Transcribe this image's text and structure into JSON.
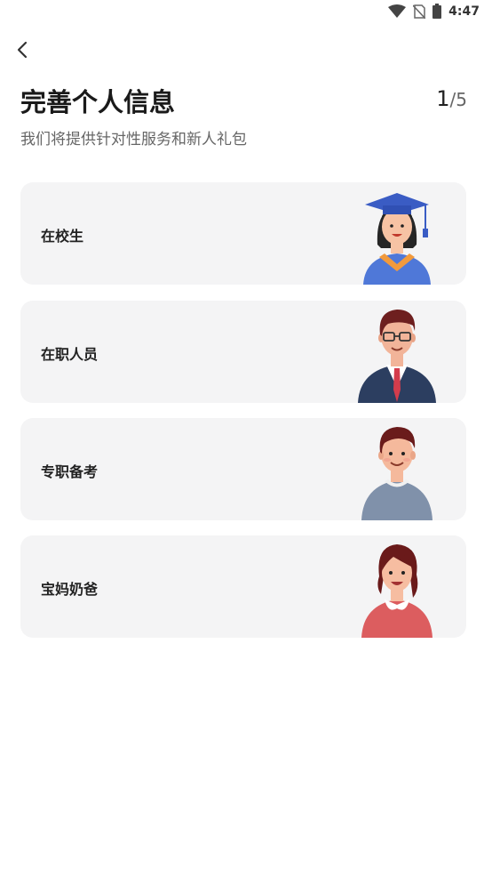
{
  "status_bar": {
    "time": "4:47"
  },
  "header": {
    "title": "完善个人信息",
    "step_current": "1",
    "step_separator": "/",
    "step_total": "5",
    "subtitle": "我们将提供针对性服务和新人礼包"
  },
  "options": [
    {
      "label": "在校生",
      "icon": "graduate-avatar"
    },
    {
      "label": "在职人员",
      "icon": "office-worker-avatar"
    },
    {
      "label": "专职备考",
      "icon": "exam-candidate-avatar"
    },
    {
      "label": "宝妈奶爸",
      "icon": "parent-avatar"
    }
  ],
  "colors": {
    "card_background": "#f4f4f5",
    "graduate_gown": "#4f78d8",
    "worker_suit": "#2c3e60",
    "student_sweater": "#8091aa",
    "parent_sweater": "#dc5d5f"
  }
}
